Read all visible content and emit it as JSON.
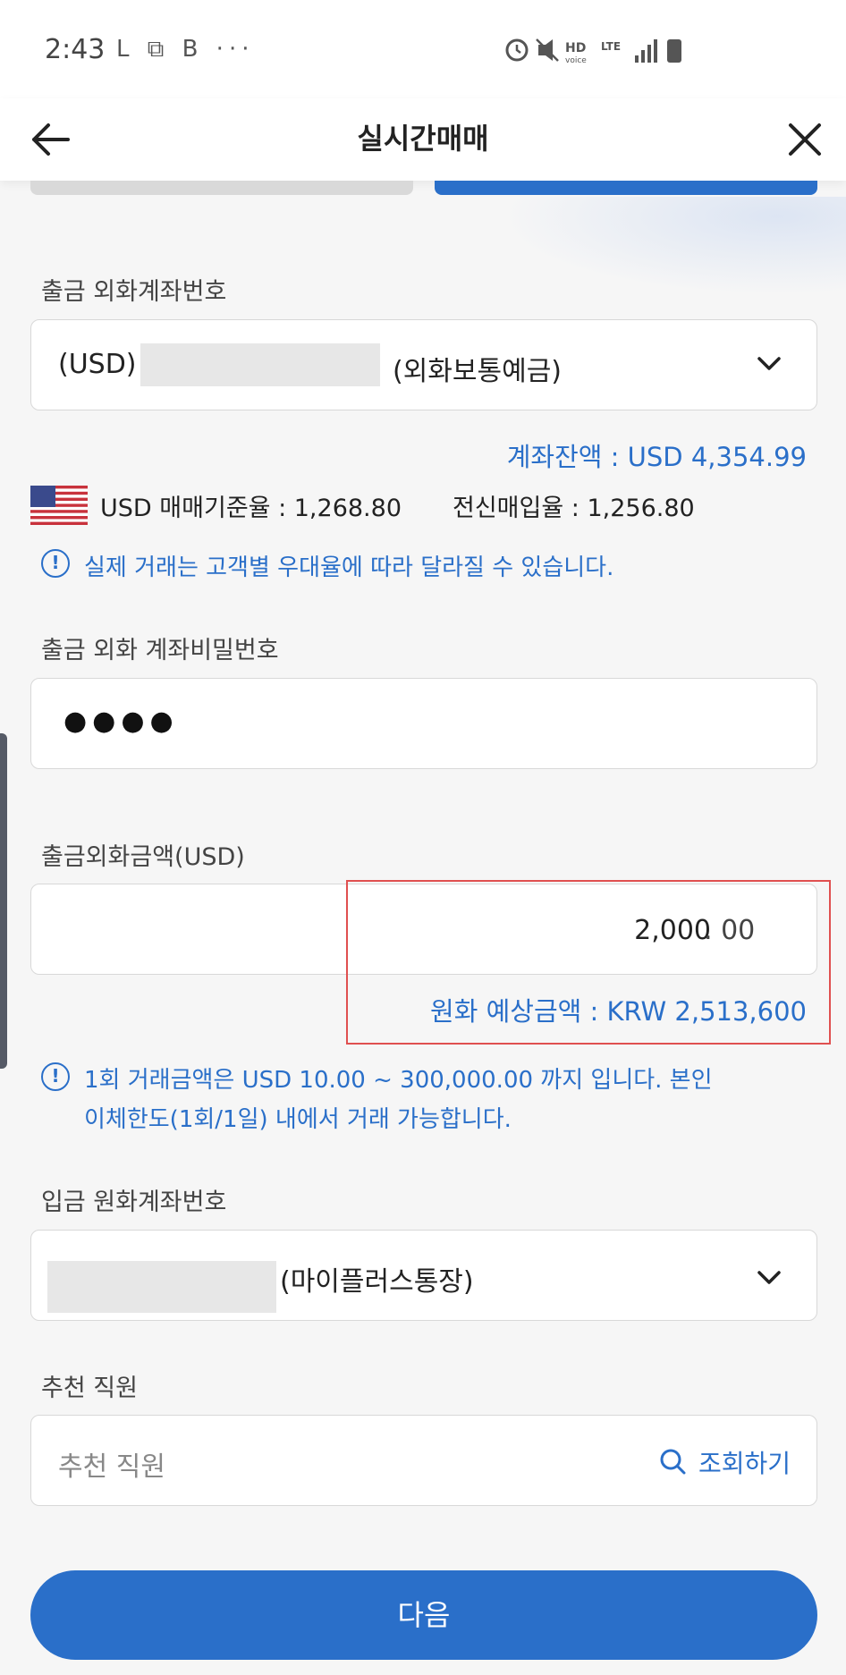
{
  "status_bar": {
    "time": "2:43",
    "left_icons": "L  ⧉  B  ···",
    "right_text": "HD LTE"
  },
  "header": {
    "title": "실시간매매"
  },
  "outgoing_account": {
    "label": "출금 외화계좌번호",
    "value_prefix": "(USD)",
    "value_suffix": "(외화보통예금)",
    "balance": "계좌잔액 : USD 4,354.99"
  },
  "rates": {
    "currency_code": "USD",
    "base_rate": "매매기준율 : 1,268.80",
    "tt_buy_rate": "전신매입율 : 1,256.80"
  },
  "notice_rate": "실제 거래는 고객별 우대율에 따라 달라질 수 있습니다.",
  "password": {
    "label": "출금 외화 계좌비밀번호",
    "value": "●●●●"
  },
  "amount": {
    "label": "출금외화금액(USD)",
    "integer": "2,000",
    "decimal": ". 00",
    "krw_estimate": "원화 예상금액 : KRW 2,513,600"
  },
  "notice_limit": {
    "line1": "1회 거래금액은 USD 10.00 ~ 300,000.00 까지 입니다. 본인",
    "line2": "이체한도(1회/1일) 내에서 거래 가능합니다."
  },
  "incoming_account": {
    "label": "입금 원화계좌번호",
    "value_suffix": "(마이플러스통장)"
  },
  "recommender": {
    "label": "추천 직원",
    "placeholder": "추천 직원",
    "search_label": "조회하기"
  },
  "next_button": "다음",
  "colors": {
    "accent": "#2a6fc9",
    "highlight_box": "#e05050"
  }
}
